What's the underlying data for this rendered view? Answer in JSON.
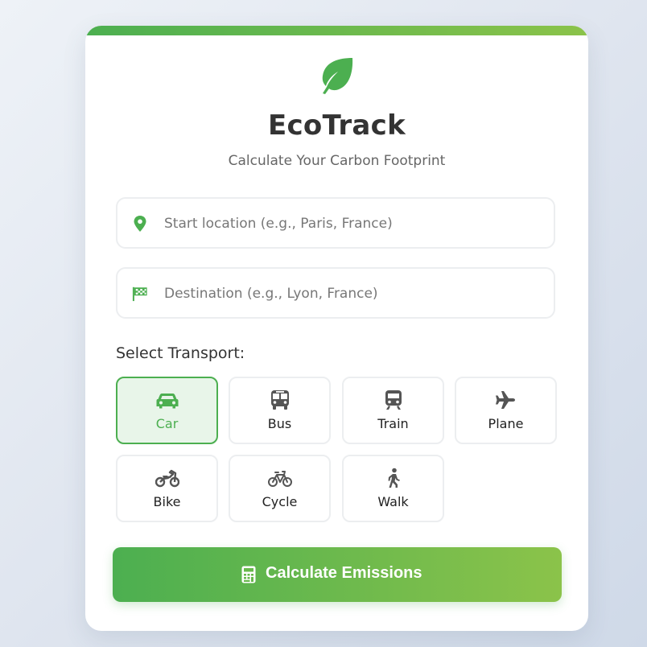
{
  "app": {
    "title": "EcoTrack",
    "subtitle": "Calculate Your Carbon Footprint",
    "logo_icon": "leaf-icon"
  },
  "form": {
    "start": {
      "value": "",
      "placeholder": "Start location (e.g., Paris, France)",
      "icon": "map-pin-icon"
    },
    "destination": {
      "value": "",
      "placeholder": "Destination (e.g., Lyon, France)",
      "icon": "checkered-flag-icon"
    },
    "transport_label": "Select Transport:",
    "transport_options": [
      {
        "label": "Car",
        "icon": "car-icon",
        "selected": true
      },
      {
        "label": "Bus",
        "icon": "bus-icon",
        "selected": false
      },
      {
        "label": "Train",
        "icon": "train-icon",
        "selected": false
      },
      {
        "label": "Plane",
        "icon": "plane-icon",
        "selected": false
      },
      {
        "label": "Bike",
        "icon": "motorcycle-icon",
        "selected": false
      },
      {
        "label": "Cycle",
        "icon": "bicycle-icon",
        "selected": false
      },
      {
        "label": "Walk",
        "icon": "walking-icon",
        "selected": false
      }
    ],
    "submit_label": "Calculate Emissions",
    "submit_icon": "calculator-icon"
  },
  "colors": {
    "accent": "#4caf50",
    "accent_light": "#8bc34a",
    "selected_bg": "#e8f5e9",
    "text_dark": "#333333",
    "icon_gray": "#555555"
  }
}
